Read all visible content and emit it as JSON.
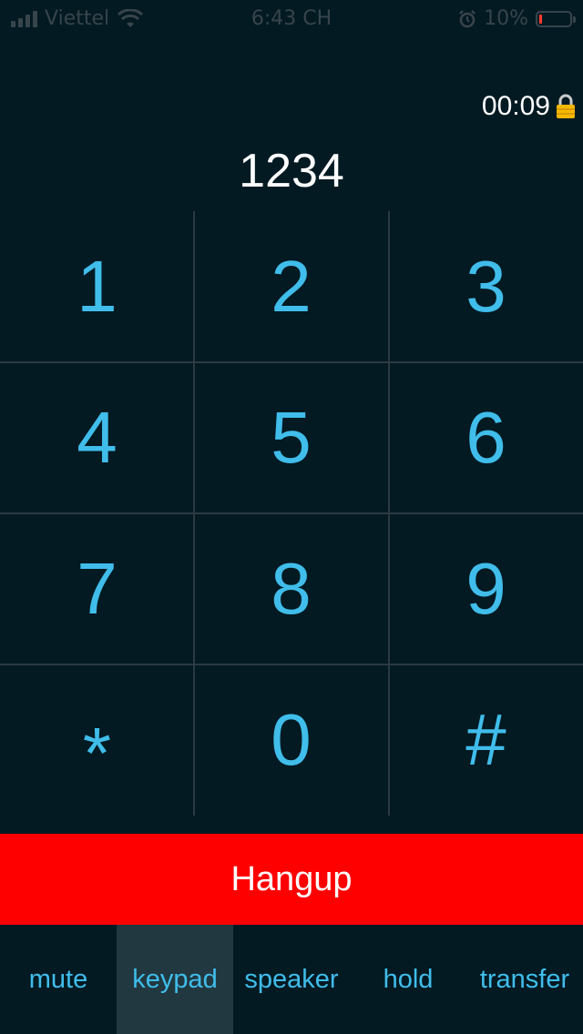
{
  "status_bar": {
    "carrier": "Viettel",
    "time": "6:43 CH",
    "battery_percent": "10%",
    "battery_level": 0.1,
    "icons": [
      "signal-icon",
      "wifi-icon",
      "alarm-icon",
      "battery-icon"
    ]
  },
  "call": {
    "timer": "00:09",
    "dialed_number": "1234"
  },
  "keypad": {
    "keys": [
      "1",
      "2",
      "3",
      "4",
      "5",
      "6",
      "7",
      "8",
      "9",
      "*",
      "0",
      "#"
    ]
  },
  "hangup_label": "Hangup",
  "bottom_bar": {
    "tabs": [
      {
        "label": "mute"
      },
      {
        "label": "keypad",
        "active": true
      },
      {
        "label": "speaker"
      },
      {
        "label": "hold"
      },
      {
        "label": "transfer"
      }
    ]
  },
  "colors": {
    "background": "#031a23",
    "accent": "#40bdea",
    "hangup": "#ff0000",
    "active_tab": "#213840",
    "battery_low": "#ff3b30"
  }
}
